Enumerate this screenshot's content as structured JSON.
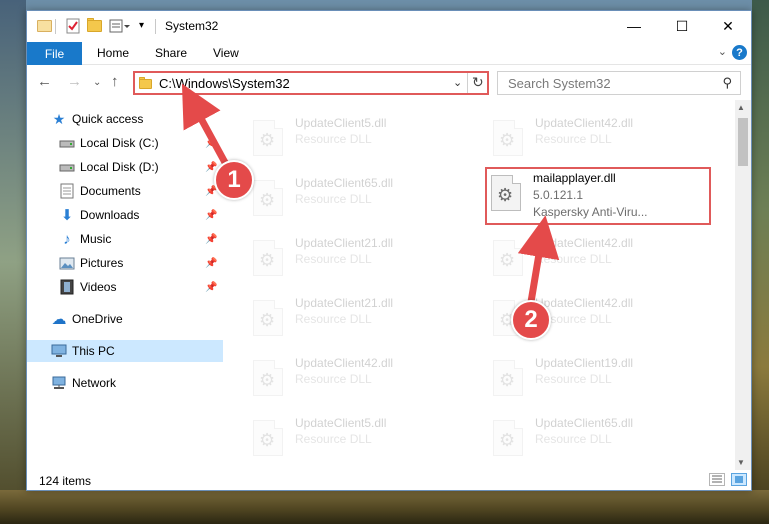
{
  "window": {
    "title": "System32",
    "controls": {
      "minimize": "—",
      "maximize": "☐",
      "close": "✕"
    }
  },
  "ribbon": {
    "tabs": [
      {
        "label": "File"
      },
      {
        "label": "Home"
      },
      {
        "label": "Share"
      },
      {
        "label": "View"
      }
    ],
    "help": "?"
  },
  "nav": {
    "address": "C:\\Windows\\System32",
    "search_placeholder": "Search System32"
  },
  "sidebar": {
    "items": [
      {
        "label": "Quick access",
        "icon": "star-icon"
      },
      {
        "label": "Local Disk (C:)",
        "icon": "drive-icon",
        "pinned": true
      },
      {
        "label": "Local Disk (D:)",
        "icon": "drive-icon",
        "pinned": true
      },
      {
        "label": "Documents",
        "icon": "documents-icon",
        "pinned": true
      },
      {
        "label": "Downloads",
        "icon": "downloads-icon",
        "pinned": true
      },
      {
        "label": "Music",
        "icon": "music-icon",
        "pinned": true
      },
      {
        "label": "Pictures",
        "icon": "pictures-icon",
        "pinned": true
      },
      {
        "label": "Videos",
        "icon": "videos-icon",
        "pinned": true
      },
      {
        "label": "OneDrive",
        "icon": "onedrive-icon"
      },
      {
        "label": "This PC",
        "icon": "this-pc-icon",
        "selected": true
      },
      {
        "label": "Network",
        "icon": "network-icon"
      }
    ]
  },
  "files": {
    "left_column": [
      {
        "name": "UpdateClient5.dll",
        "type": "Resource DLL"
      },
      {
        "name": "UpdateClient65.dll",
        "type": "Resource DLL"
      },
      {
        "name": "UpdateClient21.dll",
        "type": "Resource DLL"
      },
      {
        "name": "UpdateClient21.dll",
        "type": "Resource DLL"
      },
      {
        "name": "UpdateClient42.dll",
        "type": "Resource DLL"
      },
      {
        "name": "UpdateClient5.dll",
        "type": "Resource DLL"
      }
    ],
    "right_column": [
      {
        "name": "UpdateClient42.dll",
        "type": "Resource DLL"
      },
      {
        "name": "UpdateClient42.dll",
        "type": "Resource DLL"
      },
      {
        "name": "UpdateClient42.dll",
        "type": "Resource DLL"
      },
      {
        "name": "UpdateClient19.dll",
        "type": "Resource DLL"
      },
      {
        "name": "UpdateClient65.dll",
        "type": "Resource DLL"
      }
    ],
    "highlighted": {
      "name": "mailapplayer.dll",
      "version": "5.0.121.1",
      "company": "Kaspersky Anti-Viru..."
    }
  },
  "status": {
    "item_count": "124 items"
  },
  "annotations": {
    "step1": "1",
    "step2": "2",
    "color": "#e44a4a"
  }
}
